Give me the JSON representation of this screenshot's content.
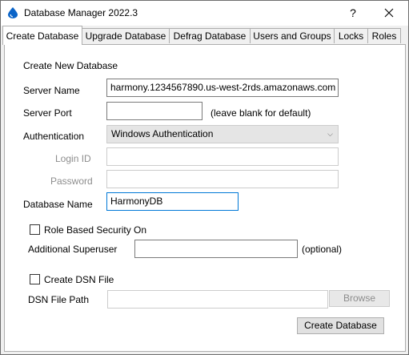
{
  "window": {
    "title": "Database Manager 2022.3",
    "help_label": "?"
  },
  "tabs": [
    {
      "label": "Create Database"
    },
    {
      "label": "Upgrade Database"
    },
    {
      "label": "Defrag Database"
    },
    {
      "label": "Users and Groups"
    },
    {
      "label": "Locks"
    },
    {
      "label": "Roles"
    }
  ],
  "form": {
    "section_title": "Create New Database",
    "server_name": {
      "label": "Server Name",
      "value": "harmony.1234567890.us-west-2rds.amazonaws.com"
    },
    "server_port": {
      "label": "Server Port",
      "value": "",
      "hint": "(leave blank for default)"
    },
    "authentication": {
      "label": "Authentication",
      "selected": "Windows Authentication"
    },
    "login_id": {
      "label": "Login ID",
      "value": ""
    },
    "password": {
      "label": "Password",
      "value": ""
    },
    "database_name": {
      "label": "Database Name",
      "value": "HarmonyDB"
    },
    "role_security": {
      "label": "Role Based Security On",
      "checked": false
    },
    "superuser": {
      "label": "Additional Superuser",
      "value": "",
      "hint": "(optional)"
    },
    "create_dsn": {
      "label": "Create DSN File",
      "checked": false
    },
    "dsn_path": {
      "label": "DSN File Path",
      "value": ""
    },
    "browse_label": "Browse",
    "create_label": "Create Database"
  },
  "colors": {
    "focus_border": "#0078d7",
    "app_icon": "#0a64c8"
  }
}
